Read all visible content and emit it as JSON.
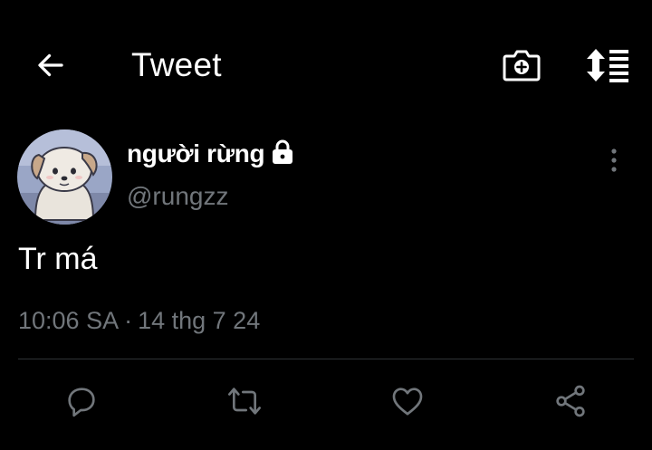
{
  "header": {
    "title": "Tweet",
    "back_icon": "arrow-left-icon",
    "camera_icon": "camera-plus-icon",
    "sort_icon": "sort-list-icon"
  },
  "tweet": {
    "author": {
      "display_name": "người rừng",
      "handle": "@rungzz",
      "protected_icon": "lock-icon",
      "avatar": "dog-avatar"
    },
    "text": "Tr má",
    "time": "10:06 SA",
    "separator": "·",
    "date": "14 thg 7 24",
    "more_icon": "more-vertical-icon"
  },
  "actions": [
    {
      "icon": "reply-icon"
    },
    {
      "icon": "retweet-icon"
    },
    {
      "icon": "heart-icon"
    },
    {
      "icon": "share-icon"
    }
  ],
  "colors": {
    "background": "#000000",
    "primary_text": "#ffffff",
    "secondary_text": "#71767b",
    "divider": "#2f3336"
  }
}
